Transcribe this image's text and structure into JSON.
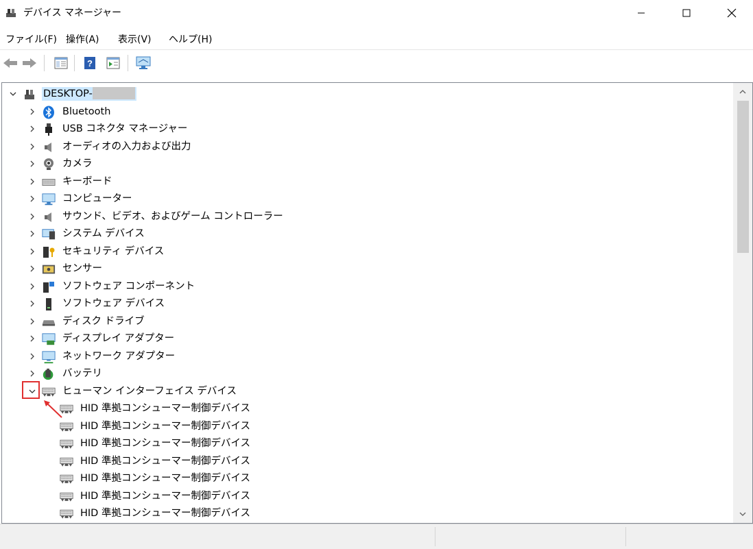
{
  "window": {
    "title": "デバイス マネージャー"
  },
  "menu": [
    "ファイル(F)",
    "操作(A)",
    "表示(V)",
    "ヘルプ(H)"
  ],
  "tree": {
    "root": "DESKTOP-",
    "categories": [
      {
        "label": "Bluetooth",
        "icon": "bluetooth-icon"
      },
      {
        "label": "USB コネクタ マネージャー",
        "icon": "usb-icon"
      },
      {
        "label": "オーディオの入力および出力",
        "icon": "speaker-icon"
      },
      {
        "label": "カメラ",
        "icon": "camera-icon"
      },
      {
        "label": "キーボード",
        "icon": "keyboard-icon"
      },
      {
        "label": "コンピューター",
        "icon": "computer-icon"
      },
      {
        "label": "サウンド、ビデオ、およびゲーム コントローラー",
        "icon": "sound-icon"
      },
      {
        "label": "システム デバイス",
        "icon": "system-device-icon"
      },
      {
        "label": "セキュリティ デバイス",
        "icon": "security-device-icon"
      },
      {
        "label": "センサー",
        "icon": "sensor-icon"
      },
      {
        "label": "ソフトウェア コンポーネント",
        "icon": "software-component-icon"
      },
      {
        "label": "ソフトウェア デバイス",
        "icon": "software-device-icon"
      },
      {
        "label": "ディスク ドライブ",
        "icon": "disk-drive-icon"
      },
      {
        "label": "ディスプレイ アダプター",
        "icon": "display-adapter-icon"
      },
      {
        "label": "ネットワーク アダプター",
        "icon": "network-adapter-icon"
      },
      {
        "label": "バッテリ",
        "icon": "battery-icon"
      }
    ],
    "expanded": {
      "label": "ヒューマン インターフェイス デバイス",
      "icon": "hid-icon",
      "children": [
        "HID 準拠コンシューマー制御デバイス",
        "HID 準拠コンシューマー制御デバイス",
        "HID 準拠コンシューマー制御デバイス",
        "HID 準拠コンシューマー制御デバイス",
        "HID 準拠コンシューマー制御デバイス",
        "HID 準拠コンシューマー制御デバイス",
        "HID 準拠コンシューマー制御デバイス"
      ]
    }
  },
  "colors": {
    "selection": "#cce8ff",
    "annotation": "#e03030",
    "scroll_thumb": "#cdcdcd"
  }
}
